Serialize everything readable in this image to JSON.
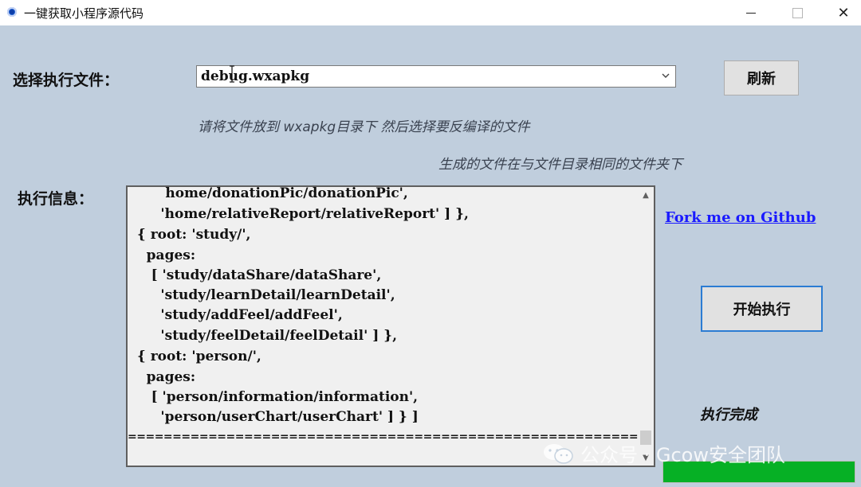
{
  "window": {
    "title": "一键获取小程序源代码",
    "minimize_icon": "minimize-icon",
    "maximize_icon": "maximize-icon",
    "close_icon": "close-icon",
    "close_glyph": "✕"
  },
  "file_select": {
    "label": "选择执行文件：",
    "selected_value": "debug.wxapkg",
    "refresh_label": "刷新"
  },
  "hints": {
    "line1": "请将文件放到   wxapkg目录下 然后选择要反编译的文件",
    "line2": "生成的文件在与文件目录相同的文件夹下"
  },
  "log": {
    "label": "执行信息：",
    "lines": [
      "        home/donationPic/donationPic',",
      "       'home/relativeReport/relativeReport' ] },",
      "  { root: 'study/',",
      "    pages:",
      "     [ 'study/dataShare/dataShare',",
      "       'study/learnDetail/learnDetail',",
      "       'study/addFeel/addFeel',",
      "       'study/feelDetail/feelDetail' ] },",
      "  { root: 'person/',",
      "    pages:",
      "     [ 'person/information/information',",
      "       'person/userChart/userChart' ] } ]",
      "=============================================================="
    ]
  },
  "side": {
    "github_link": "Fork me on Github",
    "start_label": "开始执行",
    "status_text": "执行完成",
    "progress": 1.0
  },
  "watermark": {
    "text": "公众号 · Gcow安全团队"
  },
  "colors": {
    "background": "#c0cedd",
    "link": "#1a1aff",
    "progress": "#06b025",
    "focus_border": "#2b7cd3"
  }
}
